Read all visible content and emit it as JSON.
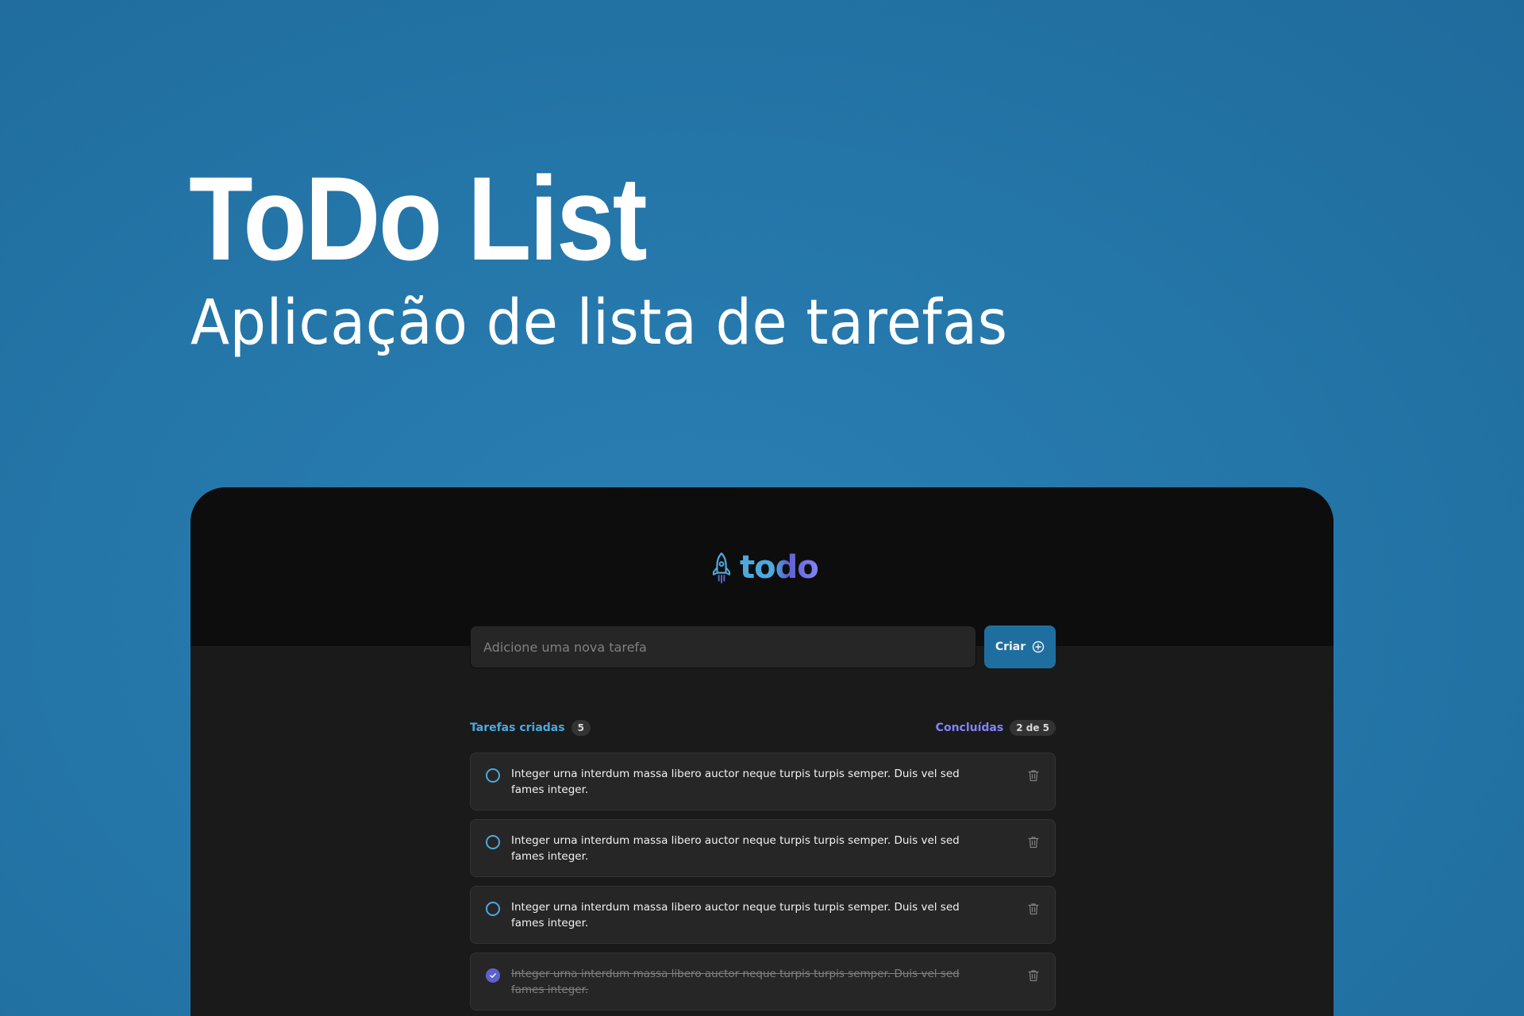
{
  "hero": {
    "title": "ToDo List",
    "subtitle": "Aplicação de lista de tarefas"
  },
  "app": {
    "logo_text": "todo",
    "logo_icon": "rocket-icon",
    "new_task_placeholder": "Adicione uma nova tarefa",
    "create_label": "Criar",
    "stats": {
      "created_label": "Tarefas criadas",
      "created_count": "5",
      "done_label": "Concluídas",
      "done_count": "2 de 5"
    },
    "tasks": [
      {
        "text": "Integer urna interdum massa libero auctor neque turpis turpis semper. Duis vel sed fames integer.",
        "done": false
      },
      {
        "text": "Integer urna interdum massa libero auctor neque turpis turpis semper. Duis vel sed fames integer.",
        "done": false
      },
      {
        "text": "Integer urna interdum massa libero auctor neque turpis turpis semper. Duis vel sed fames integer.",
        "done": false
      },
      {
        "text": "Integer urna interdum massa libero auctor neque turpis turpis semper. Duis vel sed fames integer.",
        "done": true
      }
    ]
  },
  "colors": {
    "background": "#2577aa",
    "blue": "#4ea8de",
    "blue_dark": "#1e6f9f",
    "purple": "#8284fa",
    "purple_dark": "#5e60ce"
  }
}
